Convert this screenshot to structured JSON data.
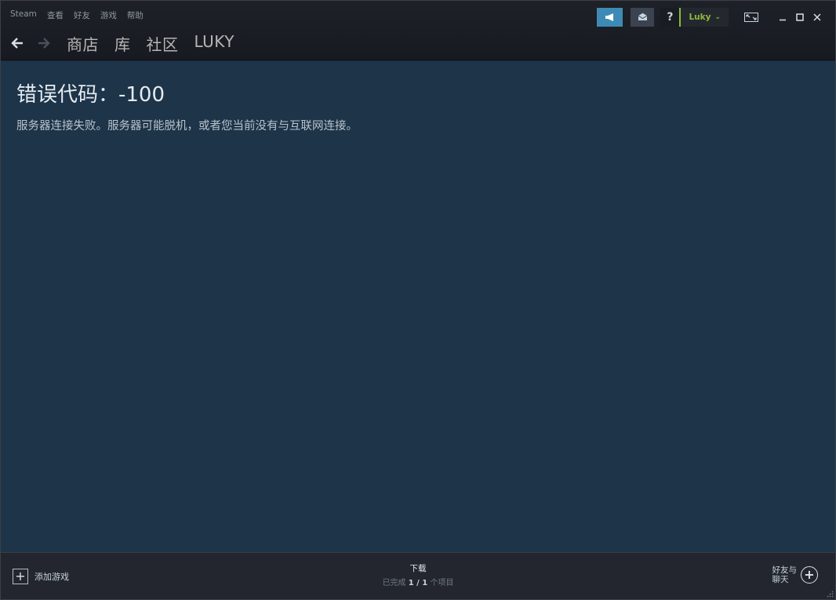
{
  "menu": [
    "Steam",
    "查看",
    "好友",
    "游戏",
    "帮助"
  ],
  "nav": {
    "links": [
      "商店",
      "库",
      "社区",
      "LUKY"
    ]
  },
  "header": {
    "username": "Luky",
    "help_label": "?"
  },
  "error": {
    "title": "错误代码：-100",
    "message": "服务器连接失败。服务器可能脱机，或者您当前没有与互联网连接。"
  },
  "footer": {
    "add_game": "添加游戏",
    "downloads_title": "下载",
    "downloads_prefix": "已完成",
    "downloads_count": "1 / 1",
    "downloads_suffix": "个项目",
    "friends_line1": "好友与",
    "friends_line2": "聊天"
  },
  "colors": {
    "accent_blue": "#3d8bb4",
    "online_green": "#8fb93b",
    "content_bg": "#1d3449"
  }
}
